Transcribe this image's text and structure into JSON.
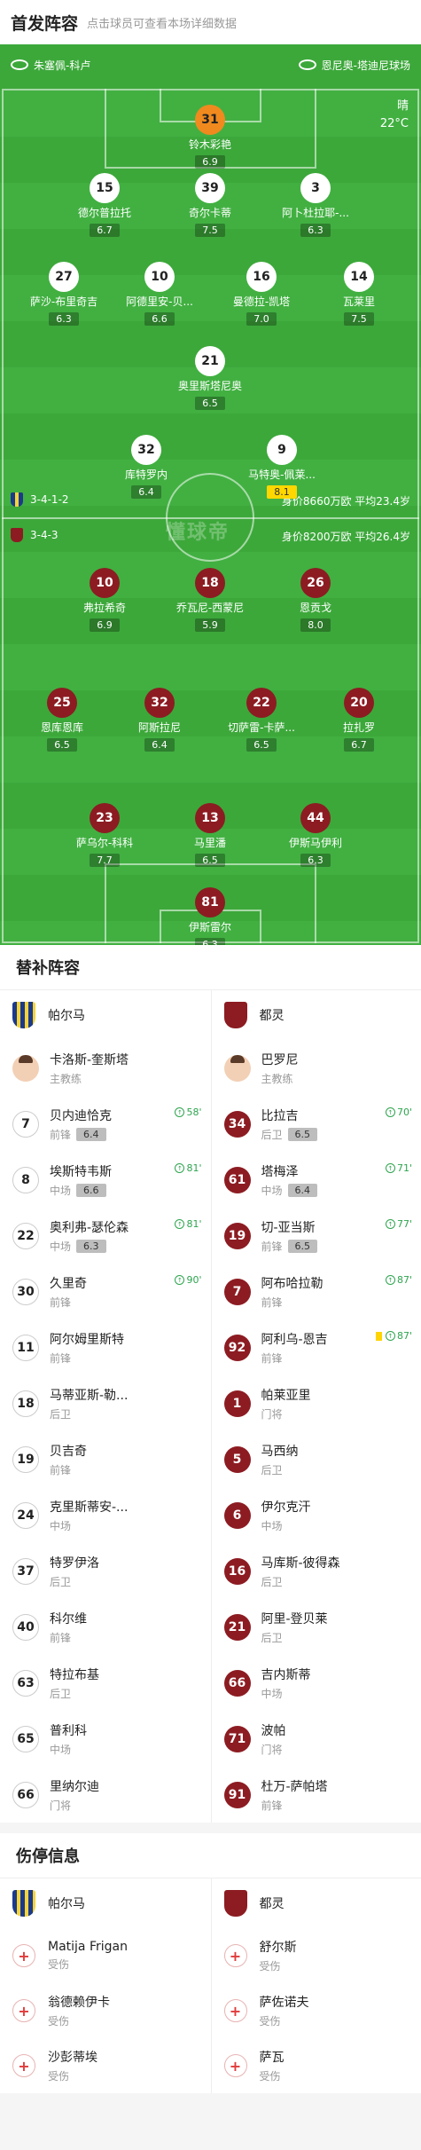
{
  "header": {
    "title": "首发阵容",
    "subtitle": "点击球员可查看本场详细数据"
  },
  "match": {
    "home_venue": "朱塞佩-科卢",
    "away_venue": "恩尼奥-塔迪尼球场",
    "weather": "晴",
    "temperature": "22°C",
    "watermark": "懂球帝"
  },
  "home": {
    "formation": "3-4-1-2",
    "info": "身价8660万欧 平均23.4岁",
    "players": [
      {
        "no": "31",
        "name": "铃木彩艳",
        "rating": "6.9"
      },
      {
        "no": "15",
        "name": "德尔普拉托",
        "rating": "6.7",
        "captain": "C",
        "yellow": true
      },
      {
        "no": "39",
        "name": "奇尔卡蒂",
        "rating": "7.5"
      },
      {
        "no": "3",
        "name": "阿卜杜拉耶-...",
        "rating": "6.3",
        "yellow": true
      },
      {
        "no": "27",
        "name": "萨沙-布里奇吉",
        "rating": "6.3"
      },
      {
        "no": "10",
        "name": "阿德里安-贝...",
        "rating": "6.6",
        "sub": "81'"
      },
      {
        "no": "16",
        "name": "曼德拉-凯塔",
        "rating": "7.0"
      },
      {
        "no": "14",
        "name": "瓦莱里",
        "rating": "7.5",
        "ball": true
      },
      {
        "no": "21",
        "name": "奥里斯塔尼奥",
        "rating": "6.5",
        "sub": "58'"
      },
      {
        "no": "32",
        "name": "库特罗内",
        "rating": "6.4",
        "sub": "81'"
      },
      {
        "no": "9",
        "name": "马特奥-佩莱...",
        "rating": "8.1",
        "sub": "90'",
        "best": true,
        "yellow": true
      }
    ]
  },
  "away": {
    "formation": "3-4-3",
    "info": "身价8200万欧 平均26.4岁",
    "players": [
      {
        "no": "10",
        "name": "弗拉希奇",
        "rating": "6.9",
        "captain": "C",
        "sub": "87'"
      },
      {
        "no": "18",
        "name": "乔瓦尼-西蒙尼",
        "rating": "5.9",
        "sub": "87'"
      },
      {
        "no": "26",
        "name": "恩贡戈",
        "rating": "8.0",
        "ball": true
      },
      {
        "no": "25",
        "name": "恩库恩库",
        "rating": "6.5",
        "sub": "70'",
        "yellow": true
      },
      {
        "no": "32",
        "name": "阿斯拉尼",
        "rating": "6.4",
        "sub": "71'"
      },
      {
        "no": "22",
        "name": "切萨雷-卡萨...",
        "rating": "6.5"
      },
      {
        "no": "20",
        "name": "拉扎罗",
        "rating": "6.7"
      },
      {
        "no": "23",
        "name": "萨乌尔-科科",
        "rating": "7.7"
      },
      {
        "no": "13",
        "name": "马里潘",
        "rating": "6.5"
      },
      {
        "no": "44",
        "name": "伊斯马伊利",
        "rating": "6.3",
        "sub": "77'"
      },
      {
        "no": "81",
        "name": "伊斯雷尔",
        "rating": "6.3"
      }
    ]
  },
  "subs": {
    "title": "替补阵容",
    "home_team": "帕尔马",
    "away_team": "都灵",
    "home_coach": {
      "name": "卡洛斯-奎斯塔",
      "role": "主教练"
    },
    "away_coach": {
      "name": "巴罗尼",
      "role": "主教练"
    },
    "home": [
      {
        "no": "7",
        "name": "贝内迪恰克",
        "pos": "前锋",
        "rating": "6.4",
        "min": "58'"
      },
      {
        "no": "8",
        "name": "埃斯特韦斯",
        "pos": "中场",
        "rating": "6.6",
        "min": "81'"
      },
      {
        "no": "22",
        "name": "奥利弗-瑟伦森",
        "pos": "中场",
        "rating": "6.3",
        "min": "81'"
      },
      {
        "no": "30",
        "name": "久里奇",
        "pos": "前锋",
        "min": "90'"
      },
      {
        "no": "11",
        "name": "阿尔姆里斯特",
        "pos": "前锋"
      },
      {
        "no": "18",
        "name": "马蒂亚斯-勒...",
        "pos": "后卫"
      },
      {
        "no": "19",
        "name": "贝吉奇",
        "pos": "前锋"
      },
      {
        "no": "24",
        "name": "克里斯蒂安-...",
        "pos": "中场"
      },
      {
        "no": "37",
        "name": "特罗伊洛",
        "pos": "后卫"
      },
      {
        "no": "40",
        "name": "科尔维",
        "pos": "前锋"
      },
      {
        "no": "63",
        "name": "特拉布基",
        "pos": "后卫"
      },
      {
        "no": "65",
        "name": "普利科",
        "pos": "中场"
      },
      {
        "no": "66",
        "name": "里纳尔迪",
        "pos": "门将"
      }
    ],
    "away": [
      {
        "no": "34",
        "name": "比拉吉",
        "pos": "后卫",
        "rating": "6.5",
        "min": "70'"
      },
      {
        "no": "61",
        "name": "塔梅泽",
        "pos": "中场",
        "rating": "6.4",
        "min": "71'"
      },
      {
        "no": "19",
        "name": "切-亚当斯",
        "pos": "前锋",
        "rating": "6.5",
        "min": "77'"
      },
      {
        "no": "7",
        "name": "阿布哈拉勒",
        "pos": "前锋",
        "min": "87'"
      },
      {
        "no": "92",
        "name": "阿利乌-恩吉",
        "pos": "前锋",
        "min": "87'",
        "yellow": true
      },
      {
        "no": "1",
        "name": "帕莱亚里",
        "pos": "门将"
      },
      {
        "no": "5",
        "name": "马西纳",
        "pos": "后卫"
      },
      {
        "no": "6",
        "name": "伊尔克汗",
        "pos": "中场"
      },
      {
        "no": "16",
        "name": "马库斯-彼得森",
        "pos": "后卫"
      },
      {
        "no": "21",
        "name": "阿里-登贝莱",
        "pos": "后卫"
      },
      {
        "no": "66",
        "name": "吉内斯蒂",
        "pos": "中场"
      },
      {
        "no": "71",
        "name": "波帕",
        "pos": "门将"
      },
      {
        "no": "91",
        "name": "杜万-萨帕塔",
        "pos": "前锋"
      }
    ]
  },
  "injuries": {
    "title": "伤停信息",
    "home": [
      {
        "name": "Matija Frigan",
        "status": "受伤"
      },
      {
        "name": "翁德赖伊卡",
        "status": "受伤"
      },
      {
        "name": "沙彭蒂埃",
        "status": "受伤"
      }
    ],
    "away": [
      {
        "name": "舒尔斯",
        "status": "受伤"
      },
      {
        "name": "萨佐诺夫",
        "status": "受伤"
      },
      {
        "name": "萨瓦",
        "status": "受伤"
      }
    ]
  }
}
